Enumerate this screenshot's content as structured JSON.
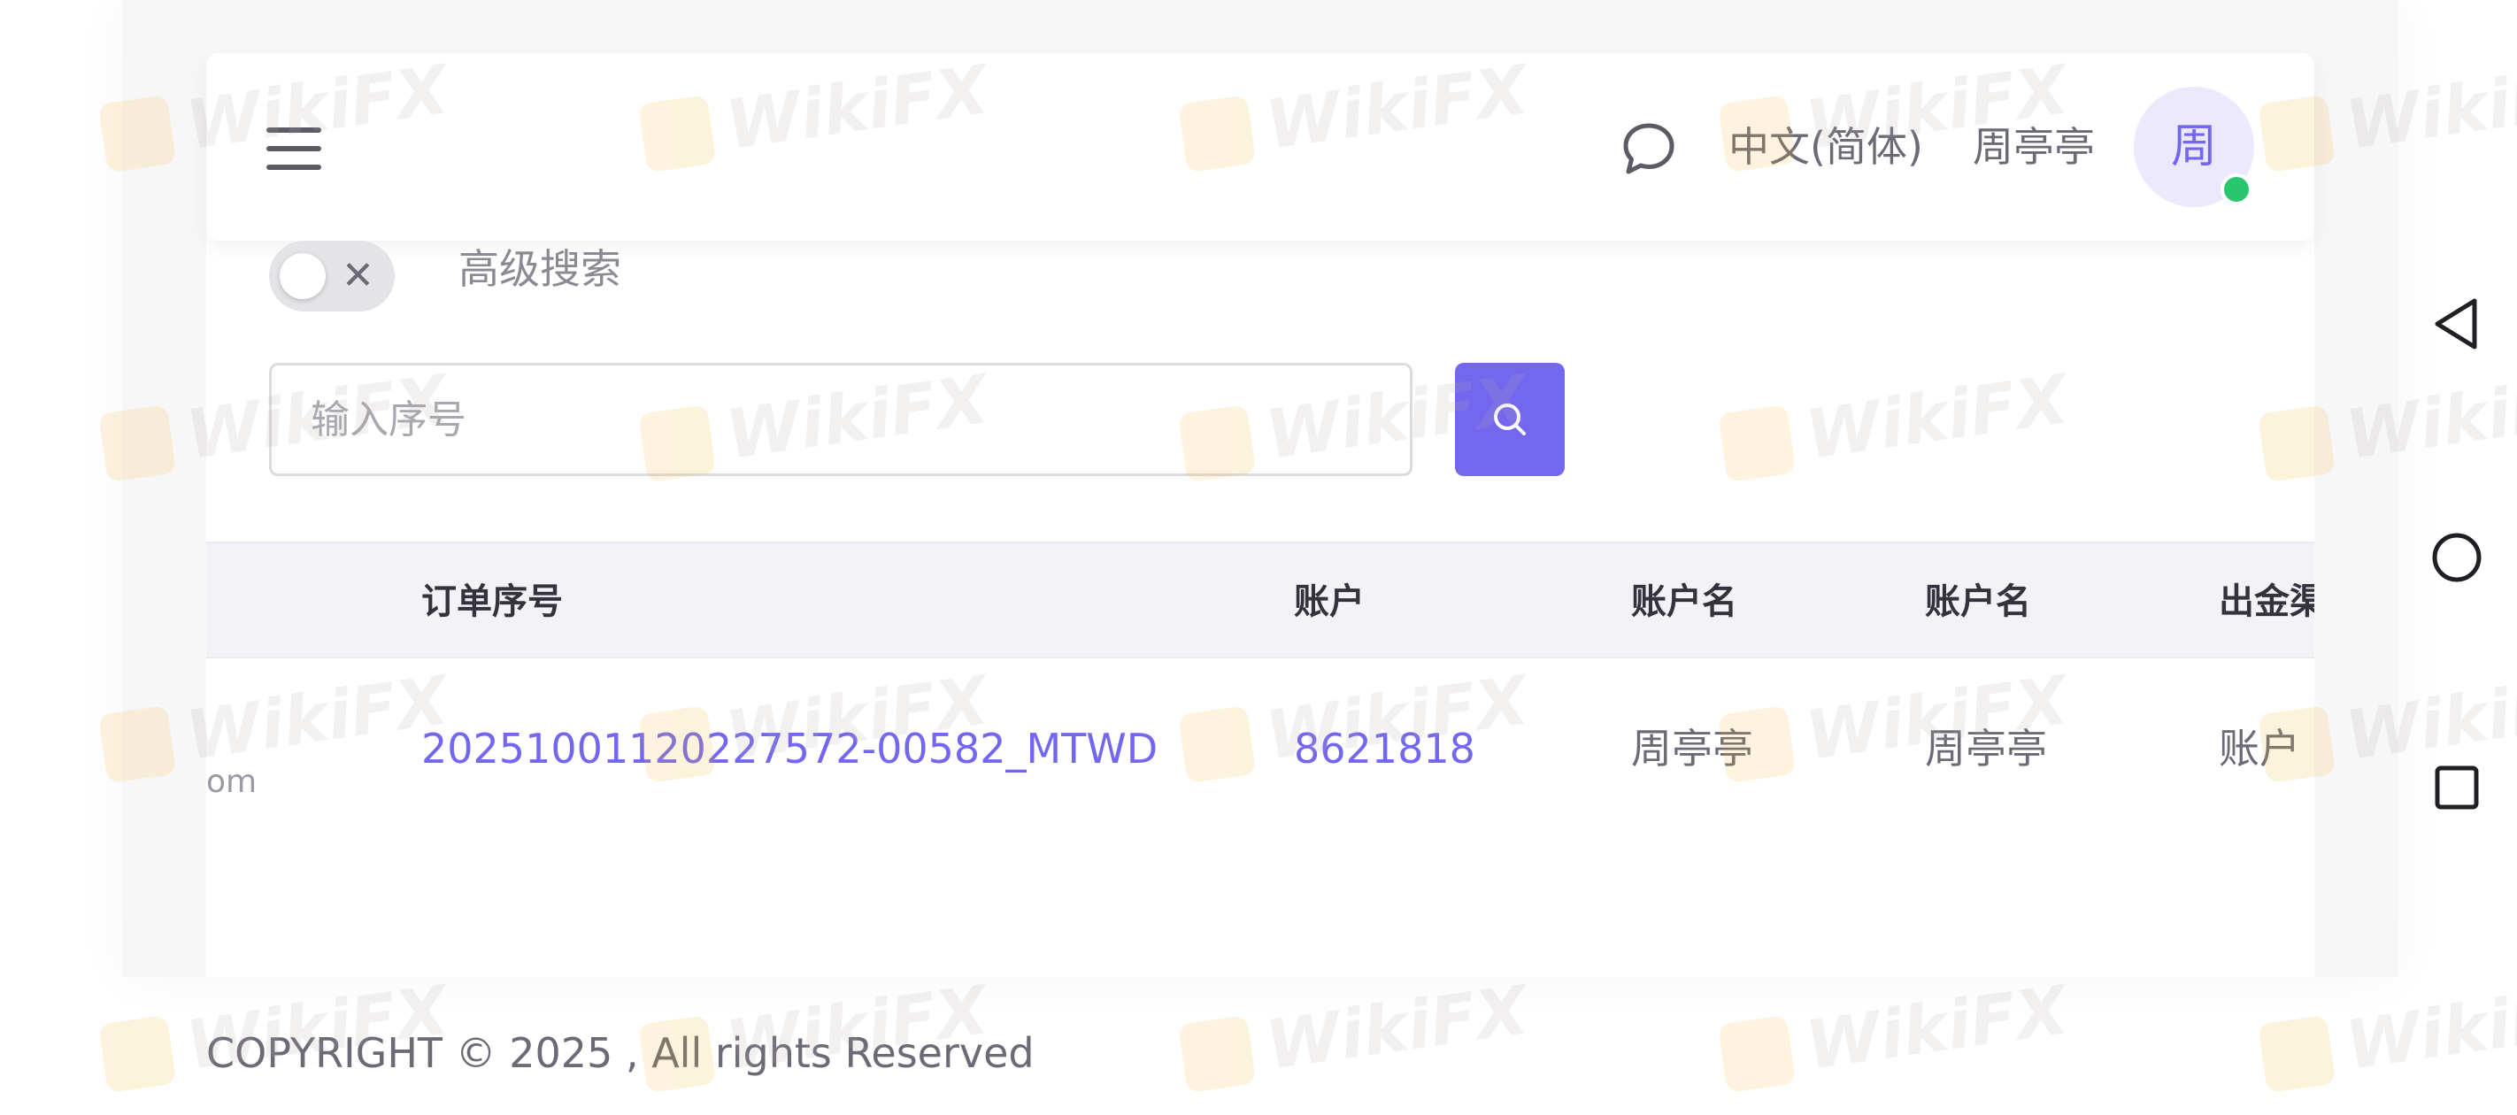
{
  "header": {
    "language": "中文(简体)",
    "username": "周亭亭",
    "avatar_initial": "周",
    "online_status_color": "#28c76f",
    "icons": {
      "menu": "hamburger-menu-icon",
      "chat": "chat-bubble-icon"
    }
  },
  "advanced_search": {
    "label": "高级搜索",
    "toggle_state": "off",
    "toggle_glyph": "✕"
  },
  "search": {
    "placeholder": "输入序号",
    "value": "",
    "button_icon": "search-icon"
  },
  "table": {
    "columns": [
      "订单序号",
      "账户",
      "账户名",
      "账户名",
      "出金渠"
    ],
    "rows": [
      {
        "order_no": "20251001120227572-00582_MTWD",
        "account": "8621818",
        "account_name": "周亭亭",
        "account_name_2": "周亭亭",
        "channel": "账户"
      }
    ],
    "partial_left_text": "om"
  },
  "footer": {
    "copyright": "COPYRIGHT © 2025 , All rights Reserved"
  },
  "system_nav": {
    "icons": [
      "back-triangle-icon",
      "home-circle-icon",
      "recents-square-icon"
    ]
  },
  "watermark": {
    "text": "WikiFX"
  },
  "colors": {
    "accent": "#7367f0",
    "table_header_bg": "#f3f2f7",
    "page_bg": "#f7f7f8",
    "watermark_logo": "#f2b632"
  }
}
